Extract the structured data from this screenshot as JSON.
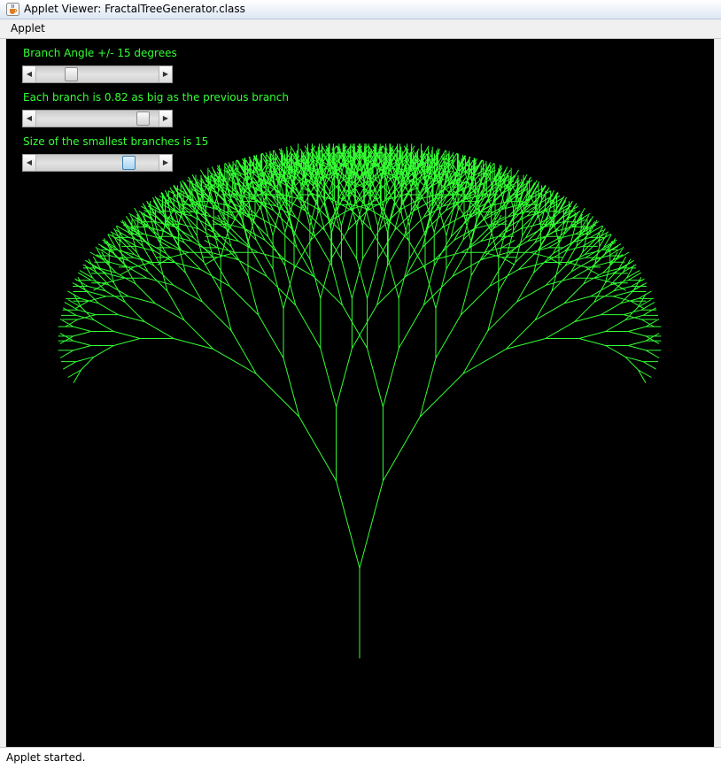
{
  "window": {
    "title": "Applet Viewer: FractalTreeGenerator.class",
    "icon": "java-cup-icon"
  },
  "menu": {
    "items": [
      "Applet"
    ]
  },
  "controls": {
    "angle": {
      "label": "Branch Angle +/- 15 degrees",
      "thumb_fraction": 0.26
    },
    "ratio": {
      "label": "Each branch is 0.82 as big as the previous branch",
      "thumb_fraction": 0.92
    },
    "min_size": {
      "label": "Size of the smallest branches is 15",
      "thumb_fraction": 0.79
    }
  },
  "tree": {
    "color": "#33ff33",
    "background": "#000000",
    "branch_angle_deg": 15,
    "branch_ratio": 0.82,
    "min_branch_size": 15
  },
  "status": {
    "text": "Applet started."
  }
}
